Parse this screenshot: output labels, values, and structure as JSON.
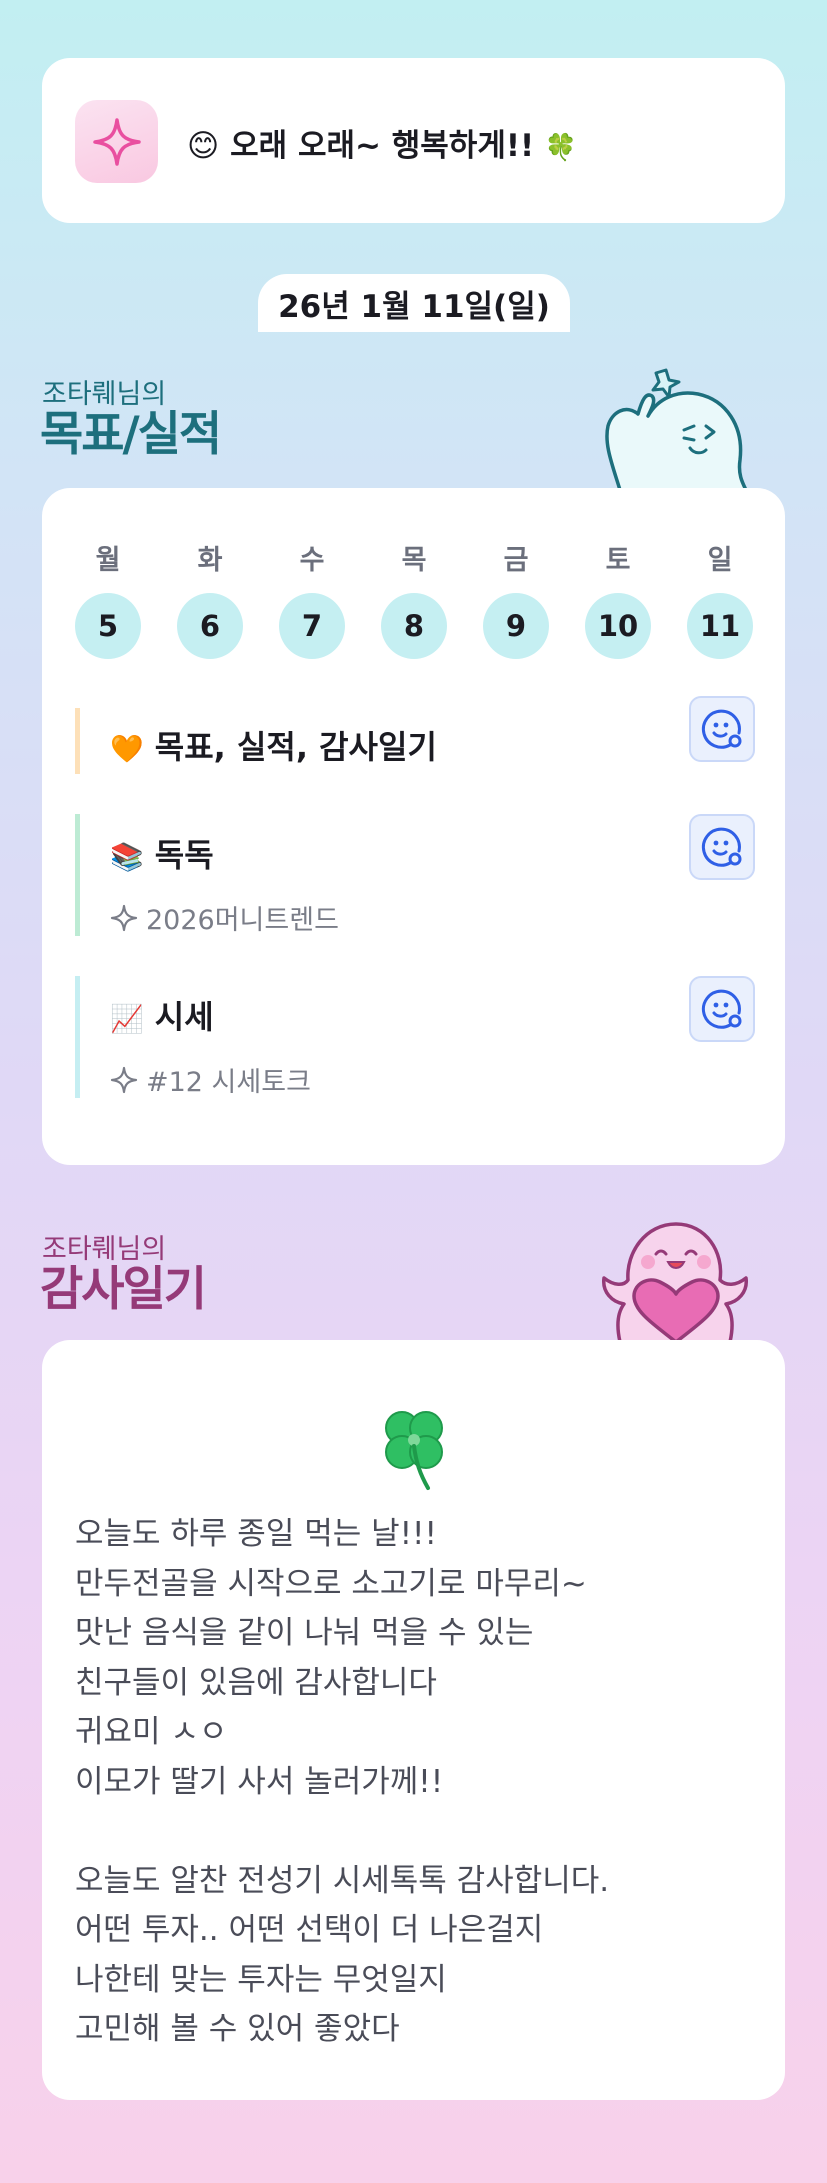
{
  "motto": {
    "emoji": "😊",
    "text": "오래 오래~ 행복하게!!",
    "trailing_emoji": "🍀",
    "icon": "sparkle-icon"
  },
  "date": "26년 1월 11일(일)",
  "goals_section": {
    "subtitle": "조타뤠님의",
    "title": "목표/실적"
  },
  "week": [
    {
      "label": "월",
      "num": "5"
    },
    {
      "label": "화",
      "num": "6"
    },
    {
      "label": "수",
      "num": "7"
    },
    {
      "label": "목",
      "num": "8"
    },
    {
      "label": "금",
      "num": "9"
    },
    {
      "label": "토",
      "num": "10"
    },
    {
      "label": "일",
      "num": "11"
    }
  ],
  "goals": [
    {
      "emoji": "🧡",
      "title": "목표, 실적, 감사일기",
      "sub": "",
      "bar_color": "#fde0b8"
    },
    {
      "emoji": "📚",
      "title": "독독",
      "sub": "2026머니트렌드",
      "bar_color": "#bdebd4"
    },
    {
      "emoji": "📈",
      "title": "시세",
      "sub": "#12 시세토크",
      "bar_color": "#c5eef2"
    }
  ],
  "gratitude_section": {
    "subtitle": "조타뤠님의",
    "title": "감사일기"
  },
  "gratitude": {
    "emoji": "🍀",
    "lines": [
      "오늘도 하루 종일 먹는 날!!!",
      "만두전골을 시작으로 소고기로 마무리~",
      "맛난 음식을 같이 나눠 먹을 수 있는",
      "친구들이 있음에 감사합니다",
      "귀요미 ㅅㅇ",
      "이모가 딸기 사서 놀러가께!!",
      "",
      "오늘도 알찬 전성기 시세톡톡 감사합니다.",
      "어떤 투자.. 어떤 선택이 더 나은걸지",
      "나한테 맞는 투자는 무엇일지",
      "고민해 볼 수 있어 좋았다"
    ]
  },
  "colors": {
    "teal": "#1d6f7d",
    "plum": "#953a78",
    "day_circle": "#c5eff2",
    "action_button": "#eaf0fd",
    "action_icon": "#2f5fe6"
  }
}
